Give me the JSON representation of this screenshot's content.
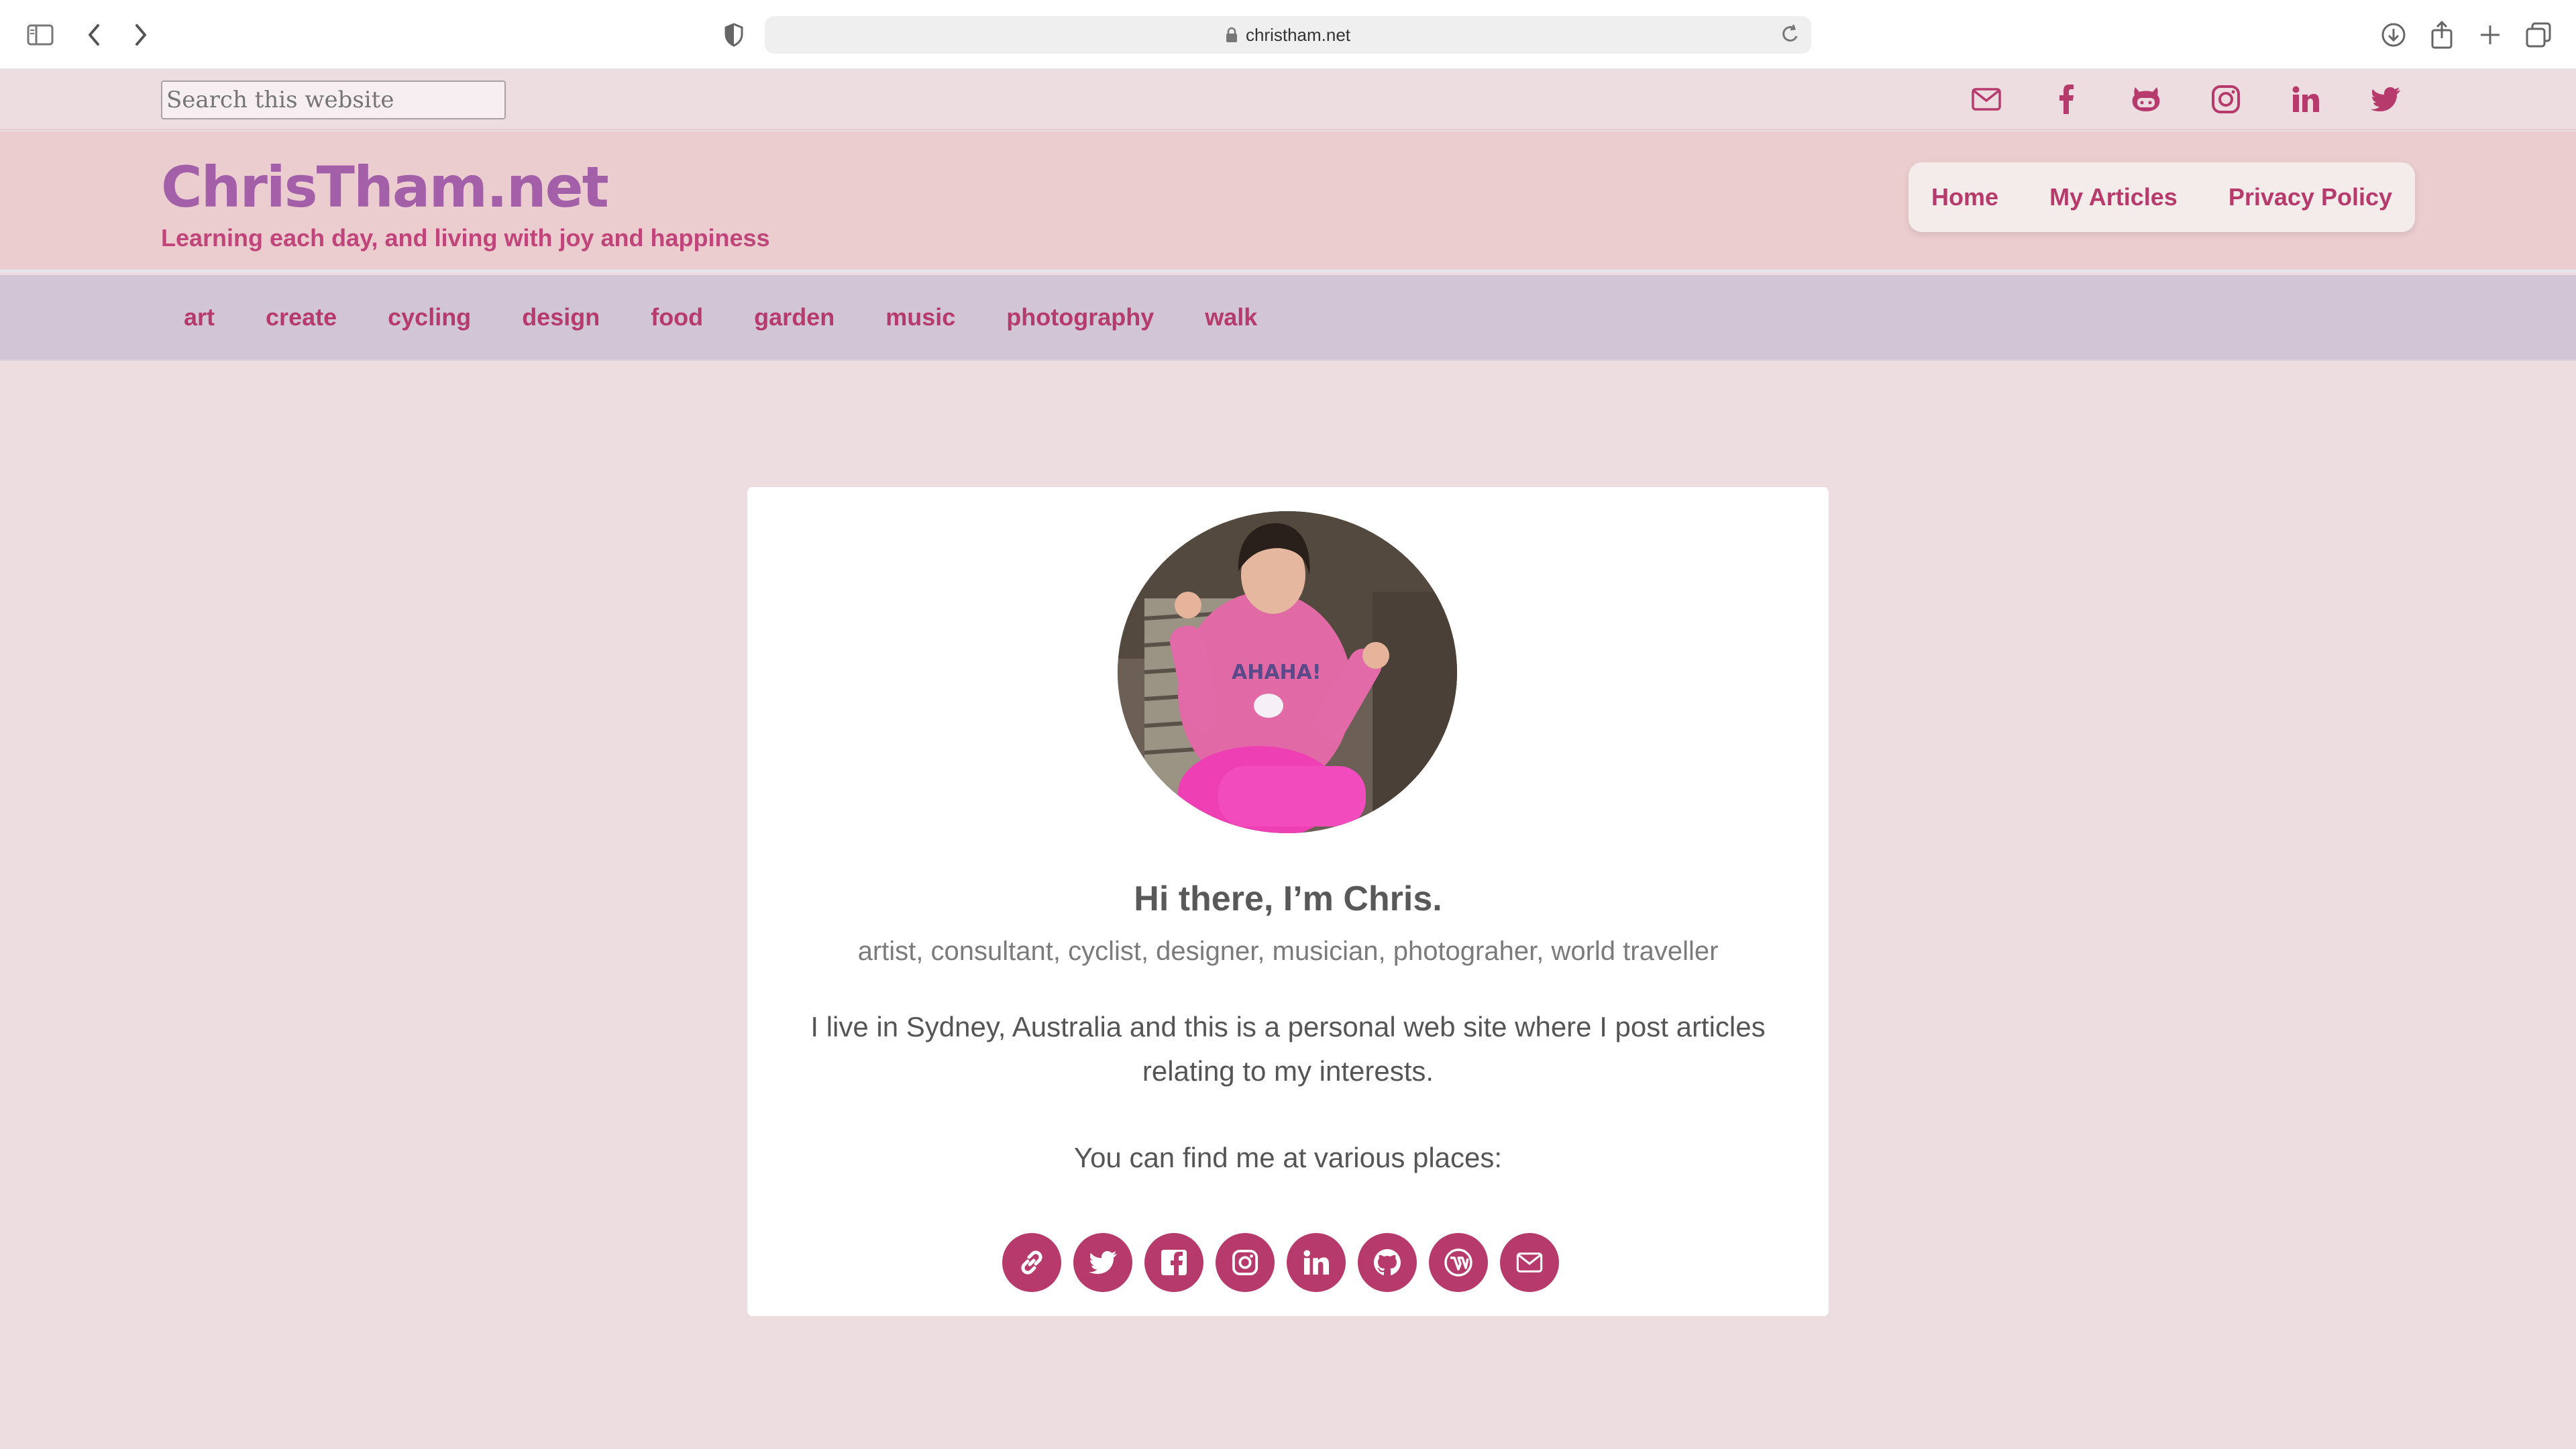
{
  "browser": {
    "url": "christham.net"
  },
  "topbar": {
    "search_placeholder": "Search this website",
    "icons": [
      "mail-icon",
      "facebook-icon",
      "github-icon",
      "instagram-icon",
      "linkedin-icon",
      "twitter-icon"
    ]
  },
  "header": {
    "site_title": "ChrisTham.net",
    "tagline": "Learning each day, and living with joy and happiness",
    "nav": [
      "Home",
      "My Articles",
      "Privacy Policy"
    ]
  },
  "categories": [
    "art",
    "create",
    "cycling",
    "design",
    "food",
    "garden",
    "music",
    "photography",
    "walk"
  ],
  "card": {
    "greeting": "Hi there, I’m Chris.",
    "roles": "artist, consultant, cyclist, designer, musician, photograher, world traveller",
    "bio": "I live in Sydney, Australia and this is a personal web site where I post articles relating to my interests.",
    "find_me": "You can find me at various places:",
    "social_icons": [
      "link-icon",
      "twitter-icon",
      "facebook-icon",
      "instagram-icon",
      "linkedin-icon",
      "github-icon",
      "wordpress-icon",
      "mail-icon"
    ]
  },
  "colors": {
    "accent": "#b63a6b",
    "title": "#a35fa8",
    "header_bg": "#ebcdcf",
    "category_bg": "#d1c5d6",
    "page_bg": "#eddde0"
  }
}
